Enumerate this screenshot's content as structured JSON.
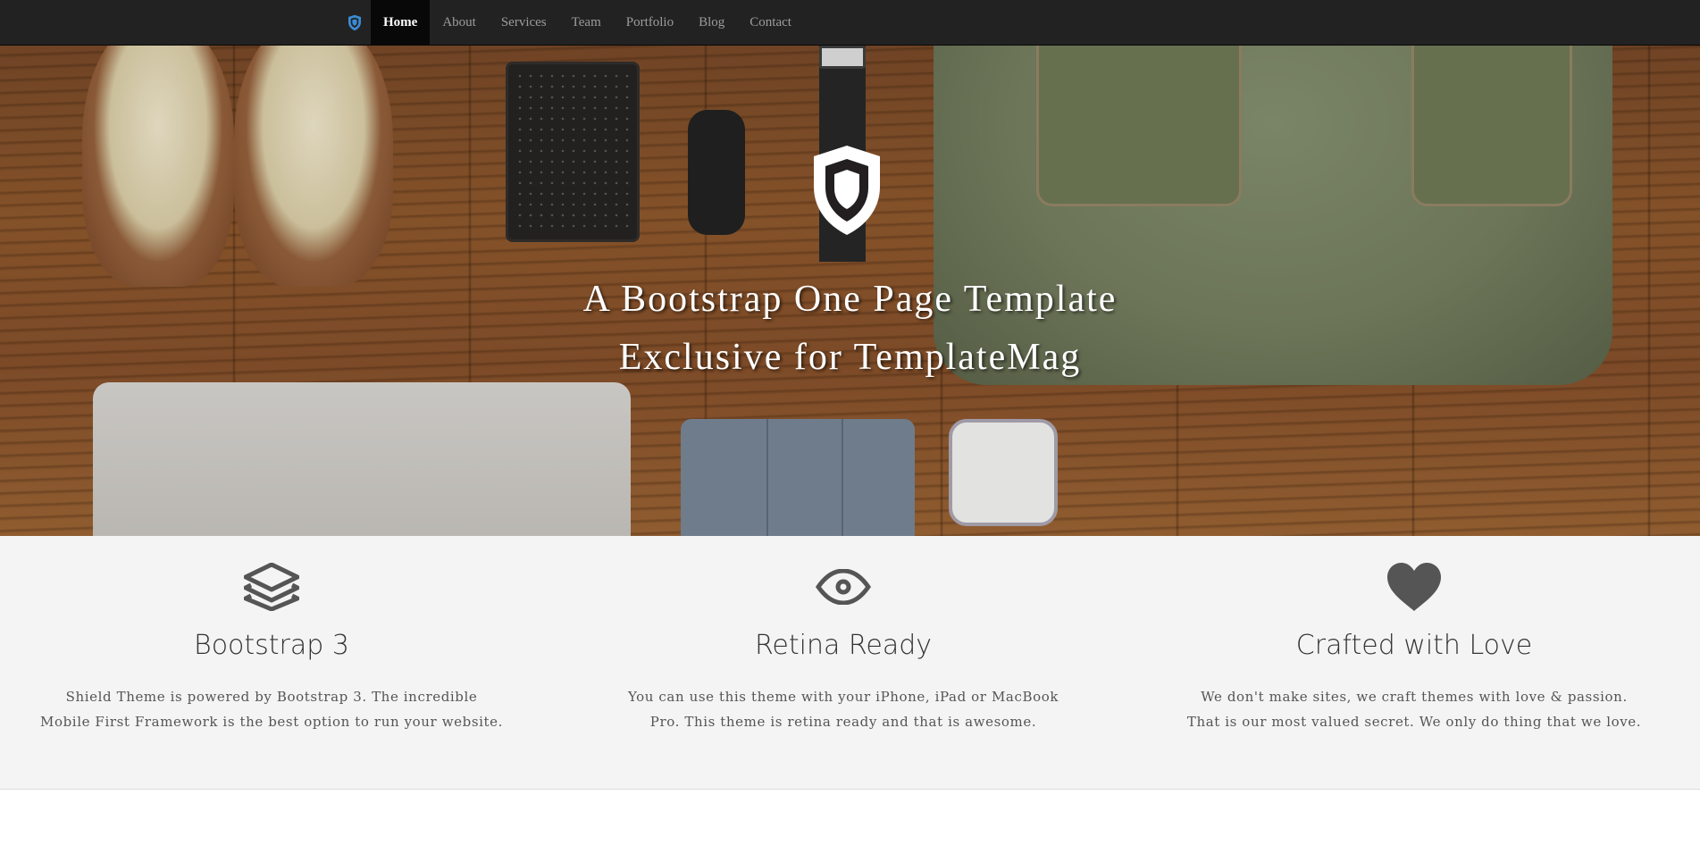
{
  "nav": {
    "brand_icon": "shield-icon",
    "items": [
      {
        "label": "Home",
        "active": true
      },
      {
        "label": "About",
        "active": false
      },
      {
        "label": "Services",
        "active": false
      },
      {
        "label": "Team",
        "active": false
      },
      {
        "label": "Portfolio",
        "active": false
      },
      {
        "label": "Blog",
        "active": false
      },
      {
        "label": "Contact",
        "active": false
      }
    ]
  },
  "hero": {
    "logo_icon": "shield-icon",
    "title_line1": "A Bootstrap One Page Template",
    "title_line2": "Exclusive for TemplateMag"
  },
  "features": [
    {
      "icon": "layers-icon",
      "title": "Bootstrap 3",
      "text": "Shield Theme is powered by Bootstrap 3. The incredible Mobile First Framework is the best option to run your website."
    },
    {
      "icon": "eye-icon",
      "title": "Retina Ready",
      "text": "You can use this theme with your iPhone, iPad or MacBook Pro. This theme is retina ready and that is awesome."
    },
    {
      "icon": "heart-icon",
      "title": "Crafted with Love",
      "text": "We don't make sites, we craft themes with love & passion. That is our most valued secret. We only do thing that we love."
    }
  ],
  "colors": {
    "navbar_bg": "#222222",
    "nav_active_bg": "#080808",
    "brand_accent": "#3b8bd6",
    "features_bg": "#f4f4f4",
    "icon_color": "#555555"
  }
}
